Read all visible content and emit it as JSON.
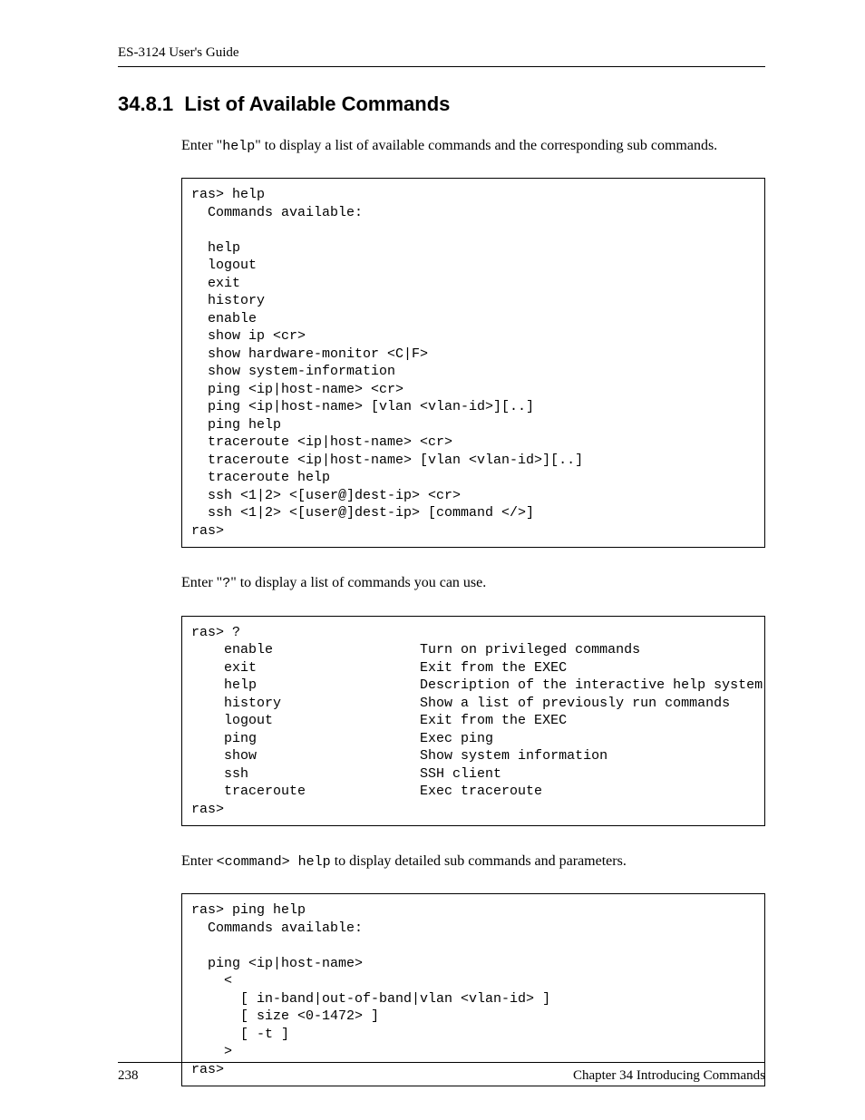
{
  "header": {
    "guide_title": "ES-3124 User's Guide"
  },
  "section": {
    "number": "34.8.1",
    "title": "List of Available Commands"
  },
  "para1": {
    "pre": "Enter \"",
    "code": "help",
    "post": "\" to display a list of available commands and the corresponding sub commands."
  },
  "code1": "ras> help\n  Commands available:\n\n  help\n  logout\n  exit\n  history\n  enable\n  show ip <cr>\n  show hardware-monitor <C|F>\n  show system-information\n  ping <ip|host-name> <cr>\n  ping <ip|host-name> [vlan <vlan-id>][..]\n  ping help\n  traceroute <ip|host-name> <cr>\n  traceroute <ip|host-name> [vlan <vlan-id>][..]\n  traceroute help\n  ssh <1|2> <[user@]dest-ip> <cr>\n  ssh <1|2> <[user@]dest-ip> [command </>]\nras>",
  "para2": {
    "pre": "Enter \"",
    "code": "?",
    "post": "\" to display a list of commands you can use."
  },
  "code2": "ras> ?\n    enable                  Turn on privileged commands\n    exit                    Exit from the EXEC\n    help                    Description of the interactive help system\n    history                 Show a list of previously run commands\n    logout                  Exit from the EXEC\n    ping                    Exec ping\n    show                    Show system information\n    ssh                     SSH client\n    traceroute              Exec traceroute\nras>",
  "para3": {
    "pre": "Enter ",
    "code": "<command> help",
    "post": "  to display detailed sub commands and parameters."
  },
  "code3": "ras> ping help\n  Commands available:\n\n  ping <ip|host-name>\n    <\n      [ in-band|out-of-band|vlan <vlan-id> ]\n      [ size <0-1472> ]\n      [ -t ]\n    >\nras>",
  "footer": {
    "page_number": "238",
    "chapter": "Chapter 34 Introducing Commands"
  }
}
